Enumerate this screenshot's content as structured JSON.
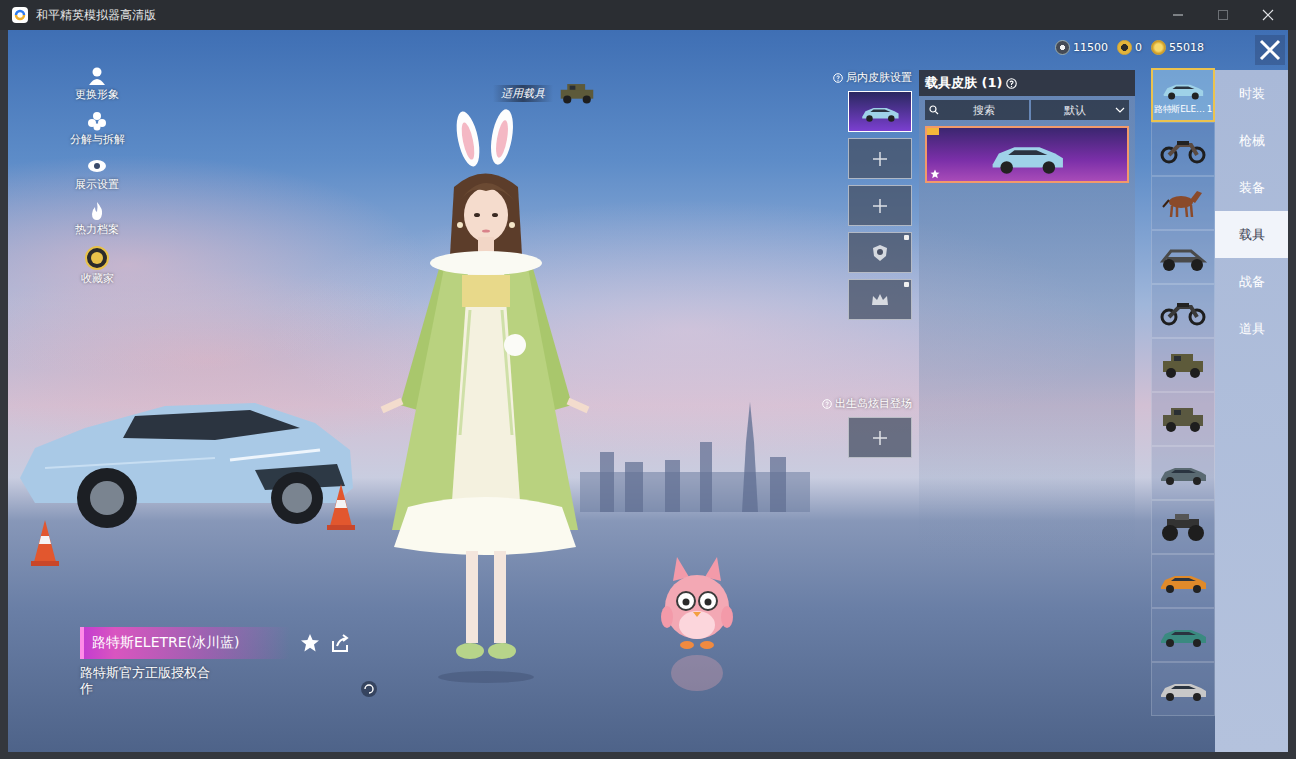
{
  "window": {
    "title": "和平精英模拟器高清版"
  },
  "currencies": [
    {
      "kind": "token",
      "amount": "11500"
    },
    {
      "kind": "medal",
      "amount": "0"
    },
    {
      "kind": "coin",
      "amount": "55018"
    }
  ],
  "side_menu": [
    {
      "kind": "avatar",
      "label": "更换形象"
    },
    {
      "kind": "decompose",
      "label": "分解与拆解"
    },
    {
      "kind": "display",
      "label": "展示设置"
    },
    {
      "kind": "heat",
      "label": "热力档案"
    },
    {
      "kind": "collector",
      "label": "收藏家"
    }
  ],
  "vehicle_tag": {
    "label": "适用载具"
  },
  "item_info": {
    "name": "路特斯ELETRE(冰川蓝)",
    "description": "路特斯官方正版授权合作",
    "favorited": false
  },
  "in_match_skins": {
    "label": "局内皮肤设置",
    "slots": [
      {
        "kind": "vehicle",
        "selected": true,
        "locked": false
      },
      {
        "kind": "empty",
        "selected": false,
        "locked": false
      },
      {
        "kind": "empty",
        "selected": false,
        "locked": false
      },
      {
        "kind": "badge",
        "selected": false,
        "locked": true
      },
      {
        "kind": "crown",
        "selected": false,
        "locked": true
      }
    ]
  },
  "spawn_entrance": {
    "label": "出生岛炫目登场",
    "slots": [
      {
        "kind": "empty",
        "selected": false,
        "locked": false
      }
    ]
  },
  "skin_panel": {
    "title": "载具皮肤 (1)",
    "search_placeholder": "搜索",
    "sort": "默认",
    "skins": [
      {
        "selected": true,
        "favorite": true,
        "color": "#9fd2e8"
      }
    ]
  },
  "vehicles": [
    {
      "kind": "car",
      "color": "#9fd2e8",
      "label": "路特斯ELE…",
      "count": "1",
      "selected": true
    },
    {
      "kind": "motorbike",
      "color": "#5a4a40",
      "selected": false
    },
    {
      "kind": "horse",
      "color": "#8a4a2a",
      "selected": false
    },
    {
      "kind": "buggy",
      "color": "#4a4a4a",
      "selected": false
    },
    {
      "kind": "motorbike",
      "color": "#3a3a3a",
      "selected": false
    },
    {
      "kind": "jeep",
      "color": "#5d5a3a",
      "selected": false
    },
    {
      "kind": "jeep",
      "color": "#5a5840",
      "selected": false
    },
    {
      "kind": "car",
      "color": "#5a6a72",
      "selected": false
    },
    {
      "kind": "truck",
      "color": "#333333",
      "selected": false
    },
    {
      "kind": "car",
      "color": "#e08a2a",
      "selected": false
    },
    {
      "kind": "car",
      "color": "#3a8a80",
      "selected": false
    },
    {
      "kind": "car",
      "color": "#c8c8c8",
      "selected": false
    }
  ],
  "categories": [
    {
      "label": "时装",
      "selected": false
    },
    {
      "label": "枪械",
      "selected": false
    },
    {
      "label": "装备",
      "selected": false
    },
    {
      "label": "载具",
      "selected": true
    },
    {
      "label": "战备",
      "selected": false
    },
    {
      "label": "道具",
      "selected": false
    }
  ]
}
